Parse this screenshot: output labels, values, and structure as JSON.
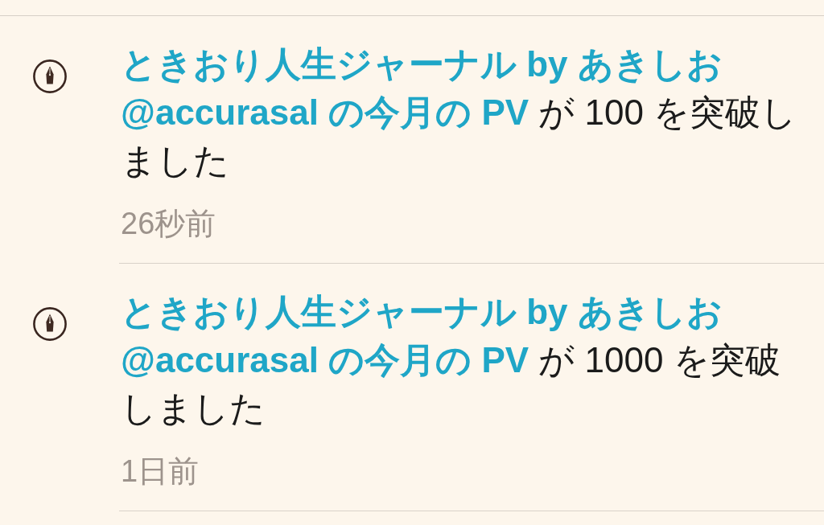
{
  "notifications": [
    {
      "message": "**ときおり人生ジャーナル by あきしお @accurasal の今月の PV** が 100 を突破しました",
      "time": "26秒前"
    },
    {
      "message": "**ときおり人生ジャーナル by あきしお @accurasal の今月の PV** が 1000 を突破しました",
      "time": "1日前"
    }
  ]
}
